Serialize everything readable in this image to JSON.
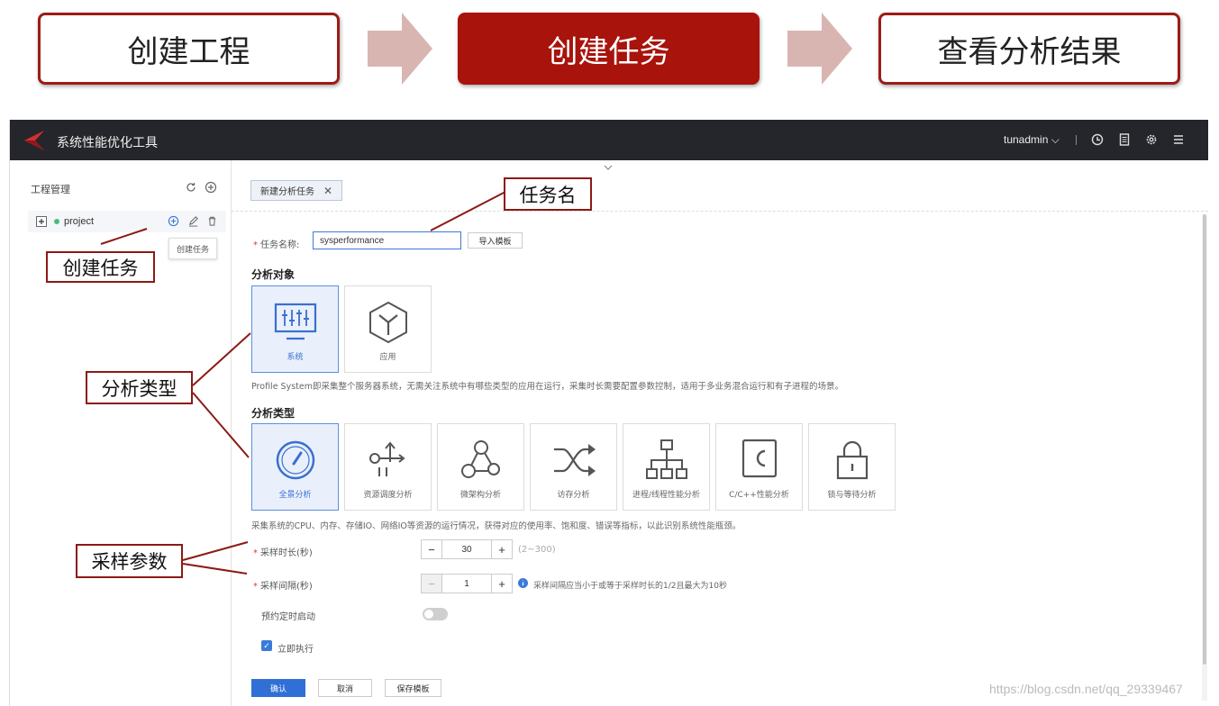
{
  "flow": {
    "steps": [
      "创建工程",
      "创建任务",
      "查看分析结果"
    ]
  },
  "topbar": {
    "title": "系统性能优化工具",
    "user": "tunadmin ⌵"
  },
  "sidebar": {
    "title": "工程管理",
    "project": "project",
    "tooltip": "创建任务"
  },
  "tab": {
    "label": "新建分析任务",
    "close": "✕"
  },
  "form": {
    "task_name_label": "任务名称:",
    "task_name_value": "sysperformance",
    "import_button": "导入模板",
    "target_section": "分析对象",
    "targets": [
      {
        "label": "系统",
        "icon": "monitor-icon"
      },
      {
        "label": "应用",
        "icon": "cube-icon"
      }
    ],
    "target_desc": "Profile System即采集整个服务器系统，无需关注系统中有哪些类型的应用在运行，采集时长需要配置参数控制，适用于多业务混合运行和有子进程的场景。",
    "type_section": "分析类型",
    "types": [
      {
        "label": "全景分析",
        "icon": "gauge-icon"
      },
      {
        "label": "资源调度分析",
        "icon": "resource-schedule-icon"
      },
      {
        "label": "微架构分析",
        "icon": "micro-arch-icon"
      },
      {
        "label": "访存分析",
        "icon": "shuffle-icon"
      },
      {
        "label": "进程/线程性能分析",
        "icon": "tree-icon"
      },
      {
        "label": "C/C++性能分析",
        "icon": "c-lang-icon"
      },
      {
        "label": "锁与等待分析",
        "icon": "lock-icon"
      }
    ],
    "type_desc": "采集系统的CPU、内存、存储IO、网络IO等资源的运行情况，获得对应的使用率、饱和度、错误等指标，以此识别系统性能瓶颈。",
    "duration_label": "采样时长(秒)",
    "duration_value": "30",
    "duration_range": "(2~300)",
    "interval_label": "采样间隔(秒)",
    "interval_value": "1",
    "interval_hint": "采样间隔应当小于或等于采样时长的1/2且最大为10秒",
    "schedule_label": "预约定时启动",
    "immediate_label": "立即执行",
    "confirm": "确认",
    "cancel": "取消",
    "save_template": "保存模板"
  },
  "callouts": {
    "task_name": "任务名",
    "create_task": "创建任务",
    "analysis_type": "分析类型",
    "sampling": "采样参数"
  },
  "watermark": "https://blog.csdn.net/qq_29339467",
  "colors": {
    "accent_red": "#a8130c",
    "primary_blue": "#2f6fd6",
    "topbar": "#25262b"
  }
}
